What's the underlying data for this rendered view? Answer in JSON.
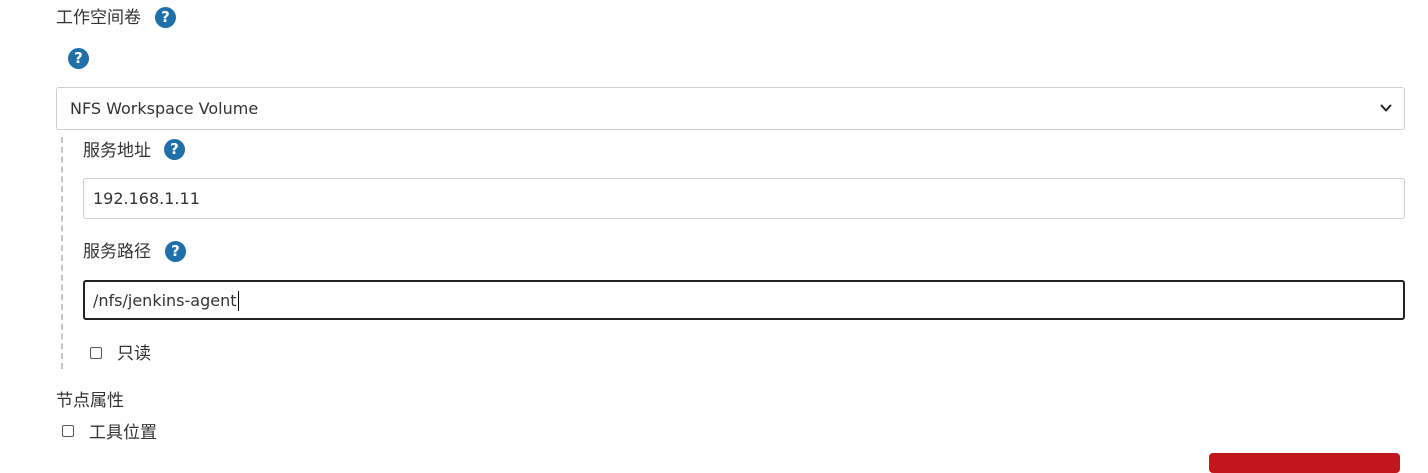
{
  "workspace_volume": {
    "label": "工作空间卷",
    "help_icon": "question-circle-icon",
    "select": {
      "selected": "NFS Workspace Volume",
      "icon": "chevron-down-icon"
    }
  },
  "nfs": {
    "server_address": {
      "label": "服务地址",
      "value": "192.168.1.11"
    },
    "server_path": {
      "label": "服务路径",
      "value": "/nfs/jenkins-agent"
    },
    "read_only": {
      "label": "只读",
      "checked": false
    }
  },
  "node_properties": {
    "label": "节点属性",
    "tool_location": {
      "label": "工具位置",
      "checked": false
    }
  },
  "colors": {
    "help_icon": "#1f6fa8",
    "primary_button": "#c0171d",
    "focused_border": "#222222"
  }
}
